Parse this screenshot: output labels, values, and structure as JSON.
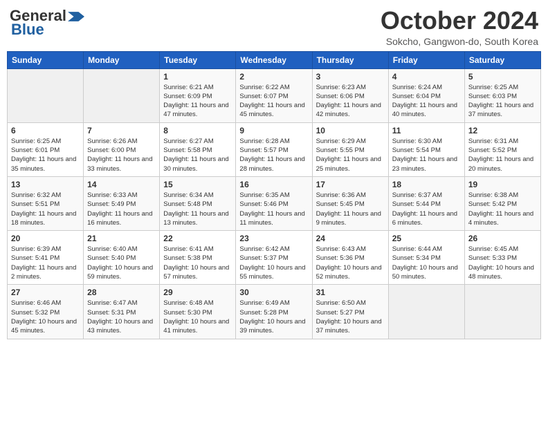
{
  "header": {
    "logo_line1": "General",
    "logo_line2": "Blue",
    "title": "October 2024",
    "subtitle": "Sokcho, Gangwon-do, South Korea"
  },
  "weekdays": [
    "Sunday",
    "Monday",
    "Tuesday",
    "Wednesday",
    "Thursday",
    "Friday",
    "Saturday"
  ],
  "weeks": [
    [
      {
        "day": "",
        "info": ""
      },
      {
        "day": "",
        "info": ""
      },
      {
        "day": "1",
        "info": "Sunrise: 6:21 AM\nSunset: 6:09 PM\nDaylight: 11 hours and 47 minutes."
      },
      {
        "day": "2",
        "info": "Sunrise: 6:22 AM\nSunset: 6:07 PM\nDaylight: 11 hours and 45 minutes."
      },
      {
        "day": "3",
        "info": "Sunrise: 6:23 AM\nSunset: 6:06 PM\nDaylight: 11 hours and 42 minutes."
      },
      {
        "day": "4",
        "info": "Sunrise: 6:24 AM\nSunset: 6:04 PM\nDaylight: 11 hours and 40 minutes."
      },
      {
        "day": "5",
        "info": "Sunrise: 6:25 AM\nSunset: 6:03 PM\nDaylight: 11 hours and 37 minutes."
      }
    ],
    [
      {
        "day": "6",
        "info": "Sunrise: 6:25 AM\nSunset: 6:01 PM\nDaylight: 11 hours and 35 minutes."
      },
      {
        "day": "7",
        "info": "Sunrise: 6:26 AM\nSunset: 6:00 PM\nDaylight: 11 hours and 33 minutes."
      },
      {
        "day": "8",
        "info": "Sunrise: 6:27 AM\nSunset: 5:58 PM\nDaylight: 11 hours and 30 minutes."
      },
      {
        "day": "9",
        "info": "Sunrise: 6:28 AM\nSunset: 5:57 PM\nDaylight: 11 hours and 28 minutes."
      },
      {
        "day": "10",
        "info": "Sunrise: 6:29 AM\nSunset: 5:55 PM\nDaylight: 11 hours and 25 minutes."
      },
      {
        "day": "11",
        "info": "Sunrise: 6:30 AM\nSunset: 5:54 PM\nDaylight: 11 hours and 23 minutes."
      },
      {
        "day": "12",
        "info": "Sunrise: 6:31 AM\nSunset: 5:52 PM\nDaylight: 11 hours and 20 minutes."
      }
    ],
    [
      {
        "day": "13",
        "info": "Sunrise: 6:32 AM\nSunset: 5:51 PM\nDaylight: 11 hours and 18 minutes."
      },
      {
        "day": "14",
        "info": "Sunrise: 6:33 AM\nSunset: 5:49 PM\nDaylight: 11 hours and 16 minutes."
      },
      {
        "day": "15",
        "info": "Sunrise: 6:34 AM\nSunset: 5:48 PM\nDaylight: 11 hours and 13 minutes."
      },
      {
        "day": "16",
        "info": "Sunrise: 6:35 AM\nSunset: 5:46 PM\nDaylight: 11 hours and 11 minutes."
      },
      {
        "day": "17",
        "info": "Sunrise: 6:36 AM\nSunset: 5:45 PM\nDaylight: 11 hours and 9 minutes."
      },
      {
        "day": "18",
        "info": "Sunrise: 6:37 AM\nSunset: 5:44 PM\nDaylight: 11 hours and 6 minutes."
      },
      {
        "day": "19",
        "info": "Sunrise: 6:38 AM\nSunset: 5:42 PM\nDaylight: 11 hours and 4 minutes."
      }
    ],
    [
      {
        "day": "20",
        "info": "Sunrise: 6:39 AM\nSunset: 5:41 PM\nDaylight: 11 hours and 2 minutes."
      },
      {
        "day": "21",
        "info": "Sunrise: 6:40 AM\nSunset: 5:40 PM\nDaylight: 10 hours and 59 minutes."
      },
      {
        "day": "22",
        "info": "Sunrise: 6:41 AM\nSunset: 5:38 PM\nDaylight: 10 hours and 57 minutes."
      },
      {
        "day": "23",
        "info": "Sunrise: 6:42 AM\nSunset: 5:37 PM\nDaylight: 10 hours and 55 minutes."
      },
      {
        "day": "24",
        "info": "Sunrise: 6:43 AM\nSunset: 5:36 PM\nDaylight: 10 hours and 52 minutes."
      },
      {
        "day": "25",
        "info": "Sunrise: 6:44 AM\nSunset: 5:34 PM\nDaylight: 10 hours and 50 minutes."
      },
      {
        "day": "26",
        "info": "Sunrise: 6:45 AM\nSunset: 5:33 PM\nDaylight: 10 hours and 48 minutes."
      }
    ],
    [
      {
        "day": "27",
        "info": "Sunrise: 6:46 AM\nSunset: 5:32 PM\nDaylight: 10 hours and 45 minutes."
      },
      {
        "day": "28",
        "info": "Sunrise: 6:47 AM\nSunset: 5:31 PM\nDaylight: 10 hours and 43 minutes."
      },
      {
        "day": "29",
        "info": "Sunrise: 6:48 AM\nSunset: 5:30 PM\nDaylight: 10 hours and 41 minutes."
      },
      {
        "day": "30",
        "info": "Sunrise: 6:49 AM\nSunset: 5:28 PM\nDaylight: 10 hours and 39 minutes."
      },
      {
        "day": "31",
        "info": "Sunrise: 6:50 AM\nSunset: 5:27 PM\nDaylight: 10 hours and 37 minutes."
      },
      {
        "day": "",
        "info": ""
      },
      {
        "day": "",
        "info": ""
      }
    ]
  ]
}
